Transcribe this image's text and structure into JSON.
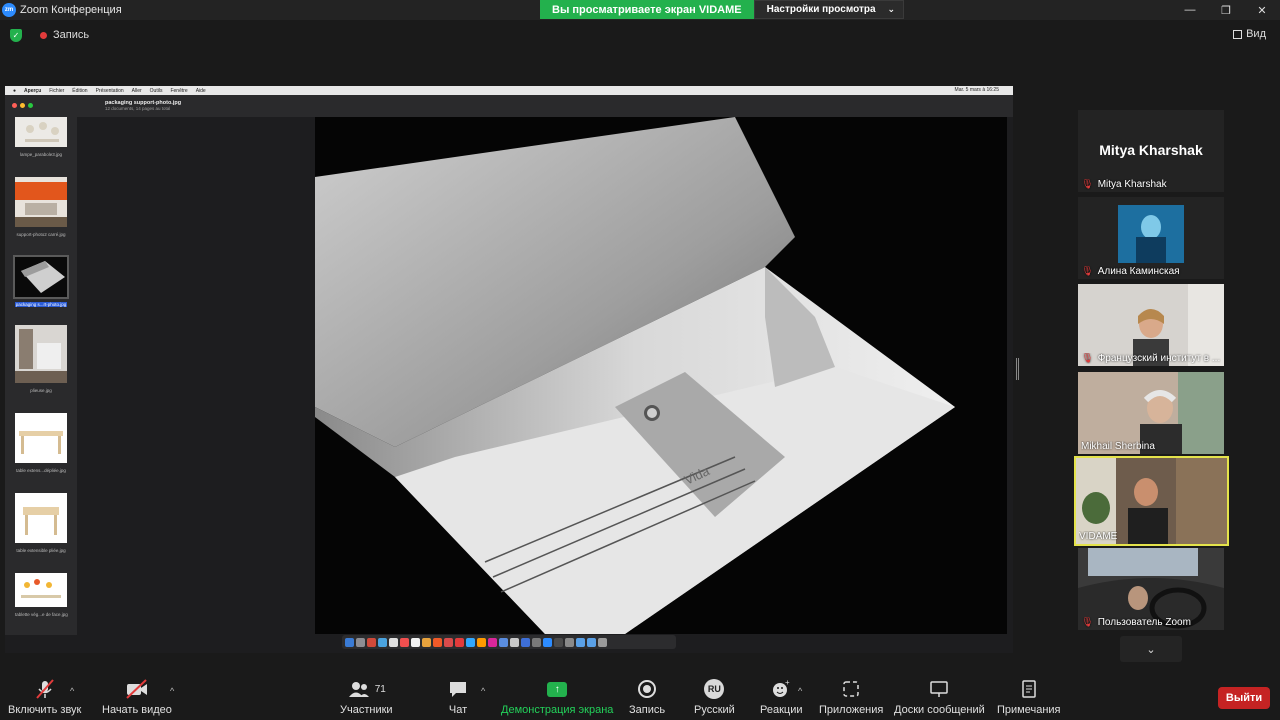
{
  "window": {
    "app_icon": "zm",
    "title": "Zoom Конференция",
    "share_banner": "Вы просматриваете экран VIDAME",
    "view_settings": "Настройки просмотра",
    "minimize": "—",
    "maximize": "❐",
    "close": "✕"
  },
  "meeting_bar": {
    "recording_label": "Запись",
    "view_label": "Вид"
  },
  "shared_screen": {
    "menubar": [
      "Aperçu",
      "Fichier",
      "Édition",
      "Présentation",
      "Aller",
      "Outils",
      "Fenêtre",
      "Aide"
    ],
    "clock": "Mar. 5 mars à 16:25",
    "document_title": "packaging support-photo.jpg",
    "document_subtitle": "12 documents, 14 pages au total",
    "thumbnails": [
      {
        "label": "lampe_parabole3.jpg"
      },
      {
        "label": "support-photo2 carré.jpg"
      },
      {
        "label": "packaging s...rt-photo.jpg",
        "selected": true
      },
      {
        "label": "plieuse.jpg"
      },
      {
        "label": "table extens...dépliée.jpg"
      },
      {
        "label": "table extensible pliée.jpg"
      },
      {
        "label": "tablette vég...e de face.jpg"
      }
    ],
    "photo_text": "Vida"
  },
  "participants": [
    {
      "name": "Mitya Kharshak",
      "big_name": "Mitya Kharshak",
      "muted": true,
      "video": false
    },
    {
      "name": "Алина Каминская",
      "muted": true,
      "video": true
    },
    {
      "name": "Французский институт в ...",
      "muted": true,
      "video": true
    },
    {
      "name": "Mikhail Sherbina",
      "muted": false,
      "video": true
    },
    {
      "name": "VIDAME",
      "muted": false,
      "video": true,
      "active": true
    },
    {
      "name": "Пользователь Zoom",
      "muted": true,
      "video": true
    }
  ],
  "toolbar": {
    "unmute": "Включить звук",
    "start_video": "Начать видео",
    "participants": "Участники",
    "participants_count": "71",
    "chat": "Чат",
    "share_screen": "Демонстрация экрана",
    "record": "Запись",
    "language_badge": "RU",
    "language": "Русский",
    "reactions": "Реакции",
    "apps": "Приложения",
    "whiteboards": "Доски сообщений",
    "notes": "Примечания",
    "leave": "Выйти"
  },
  "colors": {
    "accent_green": "#23b14d",
    "leave_red": "#c52323",
    "active_speaker": "#e4e34b",
    "mute_red": "#e23b3b"
  }
}
